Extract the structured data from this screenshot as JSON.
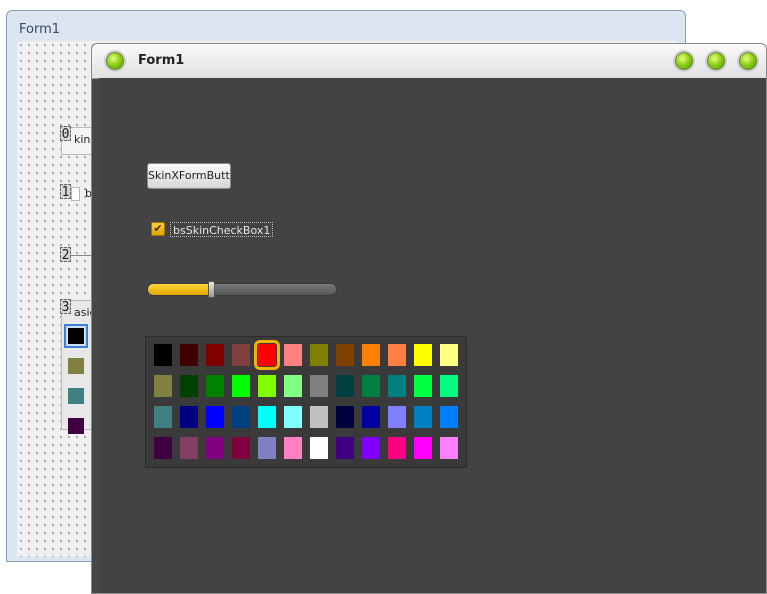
{
  "designer": {
    "title": "Form1",
    "controls": [
      {
        "tag": "0",
        "text": "kinXF"
      },
      {
        "tag": "1",
        "text": "b"
      },
      {
        "tag": "2",
        "text": ""
      },
      {
        "tag": "3",
        "text": "asic"
      }
    ],
    "palette_swatches": [
      "#000000",
      "#808040",
      "#408080",
      "#400040"
    ]
  },
  "window": {
    "title": "Form1",
    "title_buttons": [
      "minimize-icon",
      "maximize-icon",
      "close-icon"
    ],
    "button_label": "SkinXFormButto",
    "checkbox_label": "bsSkinCheckBox1",
    "checkbox_checked": true,
    "trackbar_fraction": 0.33
  },
  "palette": {
    "selected_index": 4,
    "colors": [
      "#000000",
      "#400000",
      "#800000",
      "#804040",
      "#ff0000",
      "#ff8080",
      "#808000",
      "#804000",
      "#ff8000",
      "#ff8040",
      "#ffff00",
      "#ffff80",
      "#808040",
      "#004000",
      "#008000",
      "#00ff00",
      "#80ff00",
      "#80ff80",
      "#808080",
      "#004040",
      "#008040",
      "#008080",
      "#00ff40",
      "#00ff80",
      "#408080",
      "#000080",
      "#0000ff",
      "#004080",
      "#00ffff",
      "#80ffff",
      "#c0c0c0",
      "#000040",
      "#0000a0",
      "#8080ff",
      "#0080c0",
      "#0080ff",
      "#400040",
      "#804060",
      "#800080",
      "#800040",
      "#8080c0",
      "#ff80c0",
      "#ffffff",
      "#400080",
      "#8000ff",
      "#ff0080",
      "#ff00ff",
      "#ff80ff"
    ]
  }
}
